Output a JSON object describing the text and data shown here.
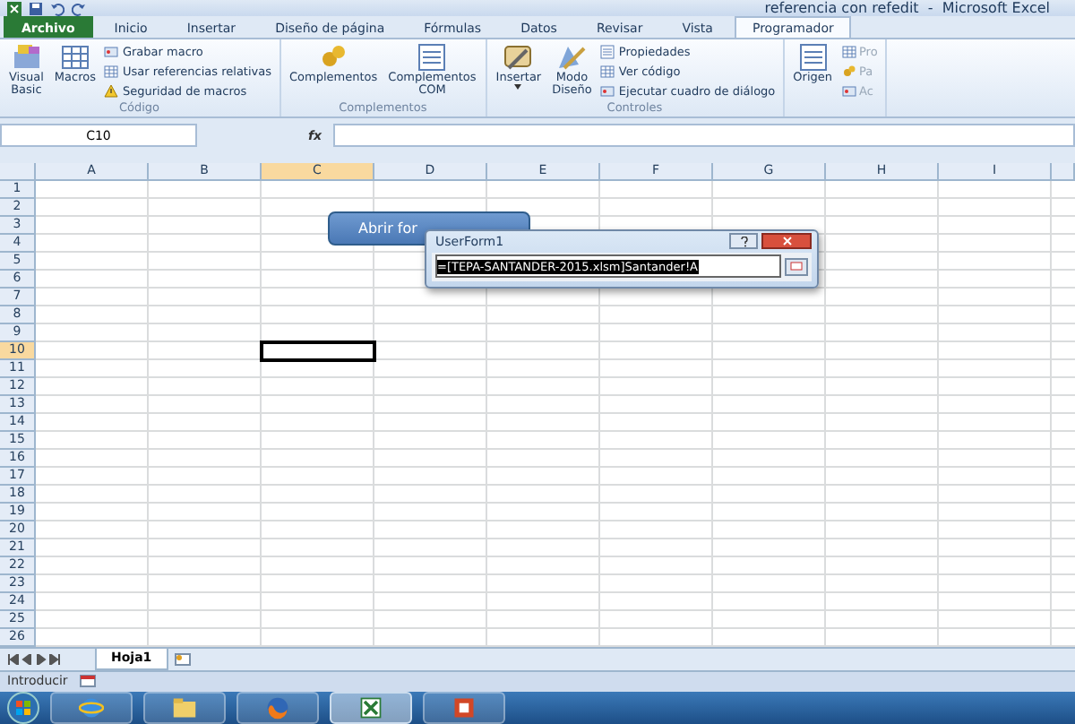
{
  "title_bar": {
    "title": "referencia con refedit  -  Microsoft Excel"
  },
  "tabs": [
    {
      "label": "Archivo",
      "kind": "file",
      "selected": false
    },
    {
      "label": "Inicio",
      "kind": "tab",
      "selected": false
    },
    {
      "label": "Insertar",
      "kind": "tab",
      "selected": false
    },
    {
      "label": "Diseño de página",
      "kind": "tab",
      "selected": false
    },
    {
      "label": "Fórmulas",
      "kind": "tab",
      "selected": false
    },
    {
      "label": "Datos",
      "kind": "tab",
      "selected": false
    },
    {
      "label": "Revisar",
      "kind": "tab",
      "selected": false
    },
    {
      "label": "Vista",
      "kind": "tab",
      "selected": false
    },
    {
      "label": "Programador",
      "kind": "tab",
      "selected": true
    }
  ],
  "ribbon_groups": [
    {
      "label": "Código",
      "items": [
        {
          "kind": "large",
          "label": "Visual\nBasic"
        },
        {
          "kind": "large",
          "label": "Macros"
        },
        {
          "kind": "stack",
          "disabled": false,
          "rows": [
            {
              "label": "Grabar macro"
            },
            {
              "label": "Usar referencias relativas"
            },
            {
              "label": "Seguridad de macros"
            }
          ]
        }
      ]
    },
    {
      "label": "Complementos",
      "items": [
        {
          "kind": "large",
          "label": "Complementos"
        },
        {
          "kind": "large",
          "label": "Complementos\nCOM"
        }
      ]
    },
    {
      "label": "Controles",
      "items": [
        {
          "kind": "large",
          "label": "Insertar",
          "dropdown": true
        },
        {
          "kind": "large",
          "label": "Modo\nDiseño"
        },
        {
          "kind": "stack",
          "disabled": false,
          "rows": [
            {
              "label": "Propiedades"
            },
            {
              "label": "Ver código"
            },
            {
              "label": "Ejecutar cuadro de diálogo"
            }
          ]
        }
      ]
    },
    {
      "items": [
        {
          "kind": "large",
          "label": "Origen"
        },
        {
          "kind": "stack",
          "disabled": true,
          "rows": [
            {
              "label": "Pro"
            },
            {
              "label": "Pa"
            },
            {
              "label": "Ac"
            }
          ]
        }
      ]
    }
  ],
  "name_box": {
    "value": "C10"
  },
  "formula_bar": {
    "function_label": "fx"
  },
  "columns": [
    {
      "label": "A",
      "selected": false
    },
    {
      "label": "B",
      "selected": false
    },
    {
      "label": "C",
      "selected": true
    },
    {
      "label": "D",
      "selected": false
    },
    {
      "label": "E",
      "selected": false
    },
    {
      "label": "F",
      "selected": false
    },
    {
      "label": "G",
      "selected": false
    },
    {
      "label": "H",
      "selected": false
    },
    {
      "label": "I",
      "selected": false
    }
  ],
  "rows": [
    {
      "label": "1",
      "selected": false
    },
    {
      "label": "2",
      "selected": false
    },
    {
      "label": "3",
      "selected": false
    },
    {
      "label": "4",
      "selected": false
    },
    {
      "label": "5",
      "selected": false
    },
    {
      "label": "6",
      "selected": false
    },
    {
      "label": "7",
      "selected": false
    },
    {
      "label": "8",
      "selected": false
    },
    {
      "label": "9",
      "selected": false
    },
    {
      "label": "10",
      "selected": true
    },
    {
      "label": "11",
      "selected": false
    },
    {
      "label": "12",
      "selected": false
    },
    {
      "label": "13",
      "selected": false
    },
    {
      "label": "14",
      "selected": false
    },
    {
      "label": "15",
      "selected": false
    },
    {
      "label": "16",
      "selected": false
    },
    {
      "label": "17",
      "selected": false
    },
    {
      "label": "18",
      "selected": false
    },
    {
      "label": "19",
      "selected": false
    },
    {
      "label": "20",
      "selected": false
    },
    {
      "label": "21",
      "selected": false
    },
    {
      "label": "22",
      "selected": false
    },
    {
      "label": "23",
      "selected": false
    },
    {
      "label": "24",
      "selected": false
    },
    {
      "label": "25",
      "selected": false
    },
    {
      "label": "26",
      "selected": false
    }
  ],
  "shape_button": {
    "label": "Abrir for"
  },
  "userform": {
    "title": "UserForm1",
    "refedit_value": "=[TEPA-SANTANDER-2015.xlsm]Santander!A"
  },
  "sheet_tabs": [
    {
      "label": "Hoja1",
      "selected": true
    }
  ],
  "status_bar": {
    "mode": "Introducir"
  },
  "taskbar": [
    {
      "kind": "ie",
      "selected": false
    },
    {
      "kind": "folder",
      "selected": false
    },
    {
      "kind": "firefox",
      "selected": false
    },
    {
      "kind": "excel",
      "selected": true
    },
    {
      "kind": "powerpoint",
      "selected": false
    }
  ]
}
